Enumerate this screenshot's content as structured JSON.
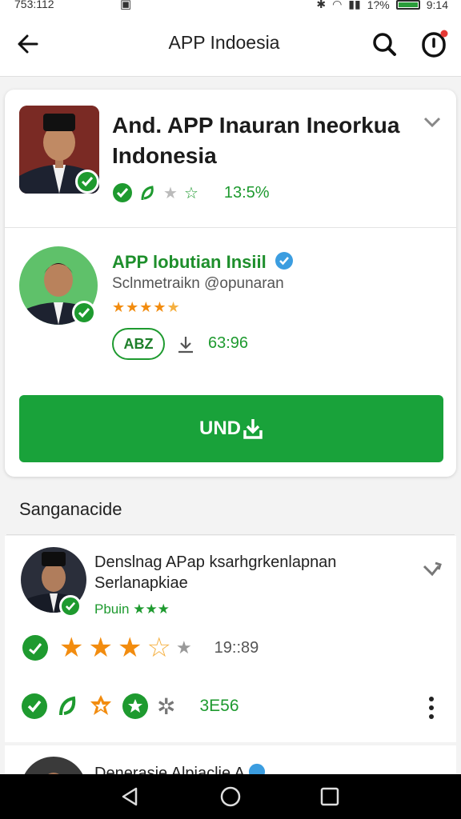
{
  "status": {
    "time": "753:112",
    "battery": "1?%",
    "clock": "9:14"
  },
  "appbar": {
    "title": "APP Indoesia"
  },
  "app": {
    "title": "And. APP Inauran Ineorkua Indonesia",
    "rating_text": "13:5%"
  },
  "developer": {
    "name": "APP lobutian Insiil",
    "subtitle": "Sclnmetraikn @opunaran",
    "tag": "ABZ",
    "downloads": "63:96"
  },
  "install": {
    "label": "UND"
  },
  "section": {
    "label": "Sanganacide"
  },
  "review": {
    "title_line1": "Denslnag APap ksarhgrkenlapnan",
    "title_line2": "Serlanapkiae",
    "sub": "Pbuin ★★★",
    "rating_value": "19::89",
    "second_value": "3E56"
  },
  "review2": {
    "title": "Denerasie Alpiaclie A"
  },
  "colors": {
    "accent": "#1e9a2f",
    "star": "#f28c0f"
  }
}
